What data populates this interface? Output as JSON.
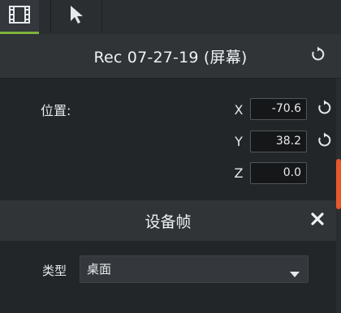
{
  "tabs": [
    {
      "name": "media",
      "icon": "film-icon",
      "active": true
    },
    {
      "name": "cursor",
      "icon": "cursor-arrow-icon",
      "active": false
    }
  ],
  "header": {
    "title": "Rec 07-27-19 (屏幕)"
  },
  "position": {
    "label": "位置:",
    "x_label": "X",
    "x_value": "-70.6",
    "y_label": "Y",
    "y_value": "38.2",
    "z_label": "Z",
    "z_value": "0.0"
  },
  "device_frame": {
    "title": "设备帧",
    "type_label": "类型",
    "type_value": "桌面"
  },
  "colors": {
    "active_tab_underline": "#7fb33a",
    "scroll_thumb": "#e8572a"
  }
}
